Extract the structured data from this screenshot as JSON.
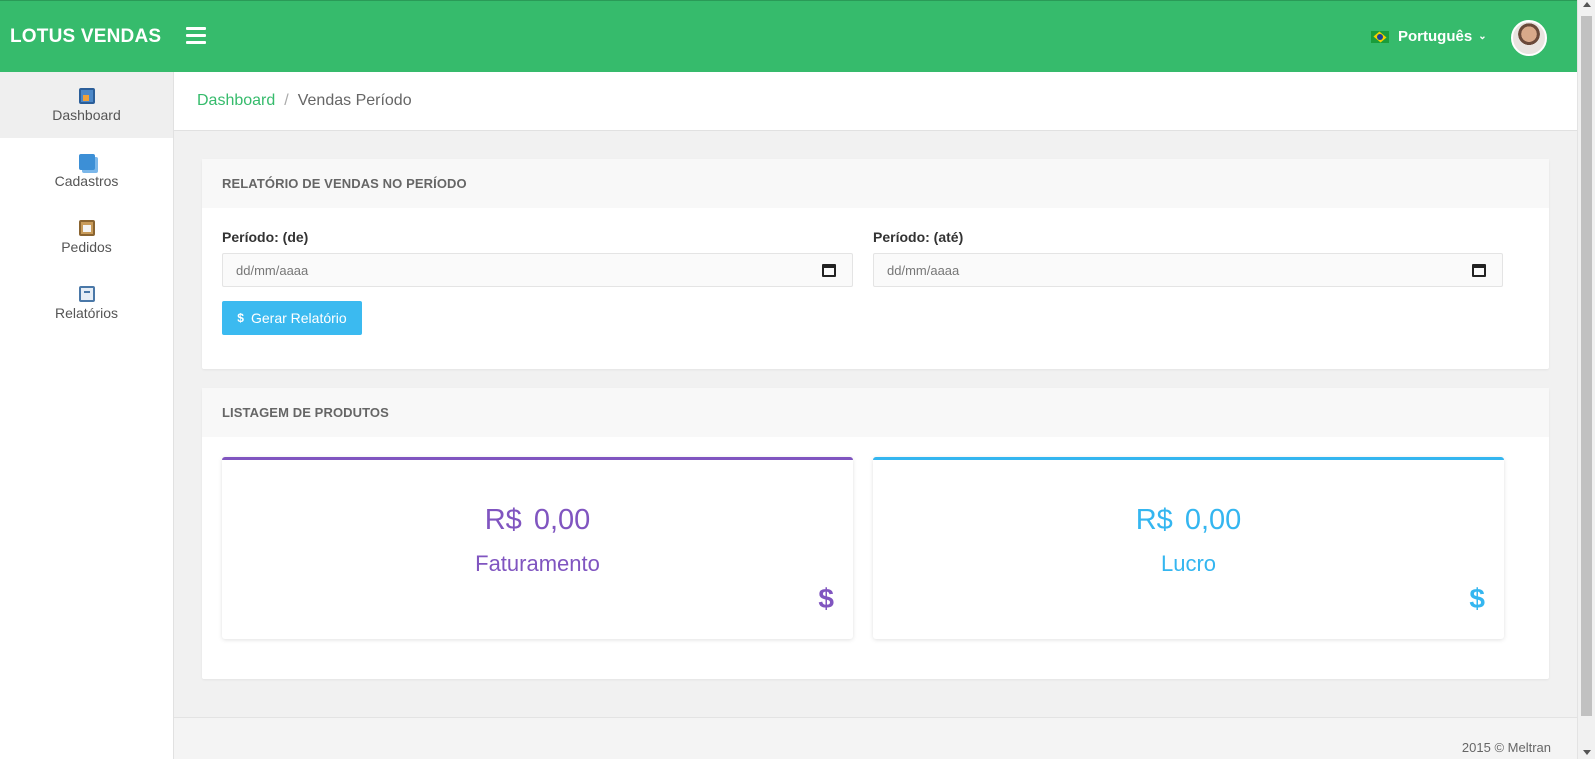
{
  "header": {
    "brand": "LOTUS VENDAS",
    "language": "Português",
    "icons": [
      "menu-icon",
      "brazil-flag-icon",
      "chevron-down-icon",
      "user-avatar"
    ],
    "color": "#36bb6c"
  },
  "sidebar": {
    "items": [
      {
        "label": "Dashboard",
        "icon": "dashboard-icon",
        "active": true
      },
      {
        "label": "Cadastros",
        "icon": "registers-icon"
      },
      {
        "label": "Pedidos",
        "icon": "clipboard-icon"
      },
      {
        "label": "Relatórios",
        "icon": "report-book-icon"
      }
    ]
  },
  "breadcrumb": {
    "home": "Dashboard",
    "separator": "/",
    "current": "Vendas Período"
  },
  "report_panel": {
    "title": "RELATÓRIO DE VENDAS NO PERÍODO",
    "from_label": "Período: (de)",
    "from_placeholder": "dd/mm/aaaa",
    "to_label": "Período: (até)",
    "to_placeholder": "dd/mm/aaaa",
    "button_icon": "$",
    "button_label": "Gerar Relatório",
    "button_color": "#3bbaf0"
  },
  "products_panel": {
    "title": "LISTAGEM DE PRODUTOS",
    "cards": [
      {
        "currency": "R$",
        "value": "0,00",
        "label": "Faturamento",
        "icon": "$",
        "color": "#8055c0"
      },
      {
        "currency": "R$",
        "value": "0,00",
        "label": "Lucro",
        "icon": "$",
        "color": "#34b6f0"
      }
    ]
  },
  "footer": {
    "text": "2015 © Meltran"
  }
}
